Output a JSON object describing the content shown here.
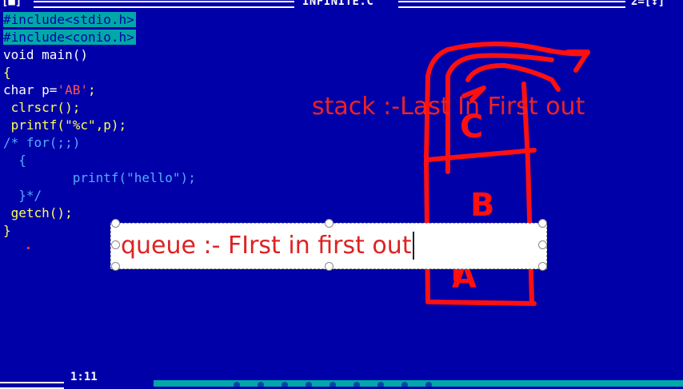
{
  "window": {
    "title": "INFINITE.C",
    "close_box": "[■]",
    "right_controls": "2=[↕]"
  },
  "code_lines": [
    "#include<stdio.h>",
    "#include<conio.h>",
    "void main()",
    "{",
    "char p='AB';",
    " clrscr();",
    " printf(\"%c\",p);",
    "/* for(;;)",
    "  {",
    "         printf(\"hello\");",
    "  }*/",
    " getch();",
    "}"
  ],
  "annotations": {
    "stack_text": "stack :-Last In First out",
    "queue_text": "queue :- FIrst in first out"
  },
  "drawing_letters": [
    "C",
    "B",
    "A"
  ],
  "status": {
    "cursor": "1:11"
  },
  "colors": {
    "background": "#0000a8",
    "highlight": "#00a8a8",
    "ink": "#ff1010"
  }
}
